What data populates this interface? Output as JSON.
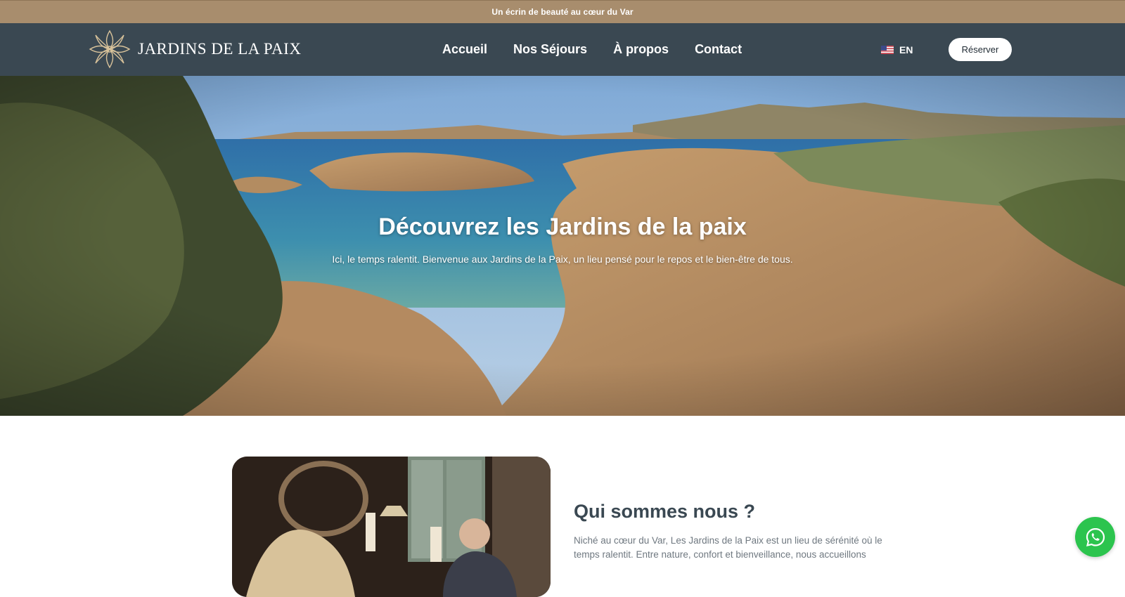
{
  "announcement": {
    "text": "Un écrin de beauté au cœur du Var"
  },
  "header": {
    "logo_text": "JARDINS DE LA PAIX",
    "nav": [
      {
        "label": "Accueil"
      },
      {
        "label": "Nos Séjours"
      },
      {
        "label": "À propos"
      },
      {
        "label": "Contact"
      }
    ],
    "language": {
      "label": "EN",
      "flag_icon": "us-flag-icon"
    },
    "reserve_button": "Réserver"
  },
  "hero": {
    "title": "Découvrez les Jardins de la paix",
    "subtitle": "Ici, le temps ralentit. Bienvenue aux Jardins de la Paix, un lieu pensé pour le repos et le bien-être de tous."
  },
  "about": {
    "title": "Qui sommes nous ?",
    "text": "Niché au cœur du Var, Les Jardins de la Paix est un lieu de sérénité où le temps ralentit. Entre nature, confort et bienveillance, nous accueillons"
  },
  "whatsapp": {
    "icon": "whatsapp-icon"
  },
  "colors": {
    "announcement_bg": "#a88d6d",
    "nav_bg": "#3a4852",
    "heading": "#3a4852",
    "body_text": "#6f7880",
    "whatsapp": "#2cc44e"
  }
}
